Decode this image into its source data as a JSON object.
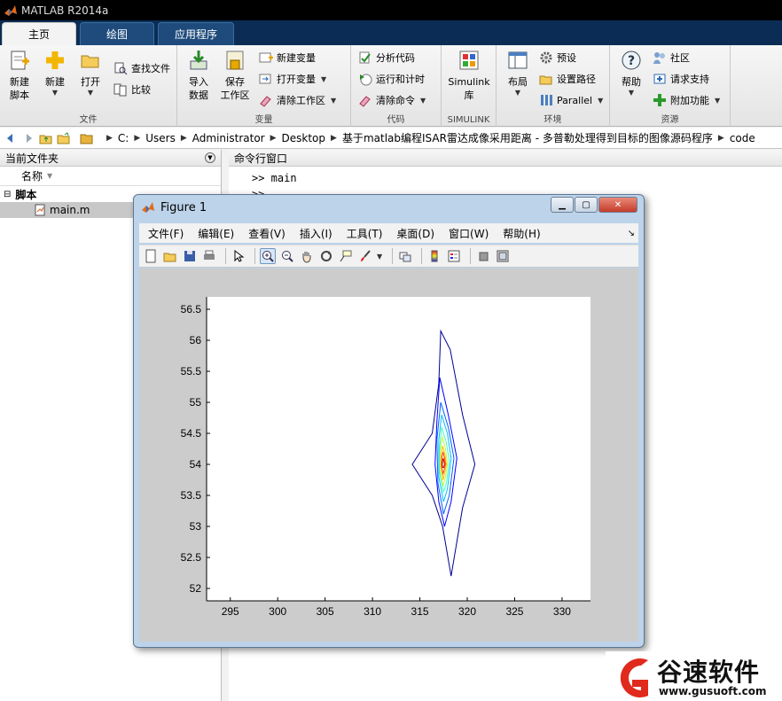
{
  "app": {
    "title": "MATLAB R2014a"
  },
  "ribbon_tabs": [
    {
      "label": "主页",
      "active": true
    },
    {
      "label": "绘图",
      "active": false
    },
    {
      "label": "应用程序",
      "active": false
    }
  ],
  "ribbon": {
    "file": {
      "label": "文件",
      "new_script": "新建\n脚本",
      "new": "新建",
      "open": "打开",
      "find_files": "查找文件",
      "compare": "比较"
    },
    "variable": {
      "label": "变量",
      "import": "导入\n数据",
      "save_workspace": "保存\n工作区",
      "new_variable": "新建变量",
      "open_variable": "打开变量",
      "clear_workspace": "清除工作区"
    },
    "code": {
      "label": "代码",
      "analyze": "分析代码",
      "run_time": "运行和计时",
      "clear_commands": "清除命令"
    },
    "simulink": {
      "label": "SIMULINK",
      "library": "Simulink\n库"
    },
    "environment": {
      "label": "环境",
      "layout": "布局",
      "preferences": "预设",
      "set_path": "设置路径",
      "parallel": "Parallel"
    },
    "resources": {
      "label": "资源",
      "help": "帮助",
      "community": "社区",
      "request_support": "请求支持",
      "addons": "附加功能"
    }
  },
  "address": {
    "crumbs": [
      "C:",
      "Users",
      "Administrator",
      "Desktop",
      "基于matlab编程ISAR雷达成像采用距离 - 多普勒处理得到目标的图像源码程序",
      "code"
    ]
  },
  "current_folder": {
    "title": "当前文件夹",
    "column": "名称",
    "group": "脚本",
    "file": "main.m"
  },
  "command_window": {
    "title": "命令行窗口",
    "prompt_line": ">> main",
    "fx_line": ">>"
  },
  "figure": {
    "title": "Figure 1",
    "menu": [
      "文件(F)",
      "编辑(E)",
      "查看(V)",
      "插入(I)",
      "工具(T)",
      "桌面(D)",
      "窗口(W)",
      "帮助(H)"
    ]
  },
  "chart_data": {
    "type": "contour",
    "title": "",
    "xlabel": "",
    "ylabel": "",
    "xlim": [
      292.5,
      333
    ],
    "ylim": [
      51.8,
      56.7
    ],
    "xticks": [
      295,
      300,
      305,
      310,
      315,
      320,
      325,
      330
    ],
    "yticks": [
      52,
      52.5,
      53,
      53.5,
      54,
      54.5,
      55,
      55.5,
      56,
      56.5
    ],
    "grid": false,
    "levels": [
      {
        "color": "#00008f",
        "points": [
          [
            317.2,
            56.15
          ],
          [
            318.2,
            55.85
          ],
          [
            319.5,
            54.8
          ],
          [
            320.8,
            54.0
          ],
          [
            319.5,
            53.3
          ],
          [
            318.3,
            52.2
          ],
          [
            317.4,
            53.0
          ],
          [
            316.3,
            53.5
          ],
          [
            314.2,
            54.0
          ],
          [
            316.3,
            54.5
          ],
          [
            317.0,
            55.3
          ]
        ]
      },
      {
        "color": "#0000ff",
        "points": [
          [
            317.1,
            55.4
          ],
          [
            318.0,
            54.8
          ],
          [
            318.9,
            54.1
          ],
          [
            318.3,
            53.4
          ],
          [
            317.6,
            53.0
          ],
          [
            317.0,
            53.4
          ],
          [
            316.6,
            54.0
          ],
          [
            316.8,
            54.7
          ]
        ]
      },
      {
        "color": "#0060ff",
        "points": [
          [
            317.2,
            55.0
          ],
          [
            318.0,
            54.6
          ],
          [
            318.6,
            54.1
          ],
          [
            318.1,
            53.5
          ],
          [
            317.5,
            53.2
          ],
          [
            316.9,
            53.7
          ],
          [
            316.8,
            54.4
          ]
        ]
      },
      {
        "color": "#00bfff",
        "points": [
          [
            317.3,
            54.8
          ],
          [
            317.9,
            54.5
          ],
          [
            318.3,
            54.1
          ],
          [
            317.9,
            53.6
          ],
          [
            317.5,
            53.4
          ],
          [
            317.0,
            53.8
          ],
          [
            317.0,
            54.4
          ]
        ]
      },
      {
        "color": "#40ffbf",
        "points": [
          [
            317.3,
            54.6
          ],
          [
            317.8,
            54.35
          ],
          [
            318.1,
            54.05
          ],
          [
            317.8,
            53.7
          ],
          [
            317.5,
            53.55
          ],
          [
            317.1,
            53.85
          ],
          [
            317.1,
            54.3
          ]
        ]
      },
      {
        "color": "#bfff40",
        "points": [
          [
            317.35,
            54.45
          ],
          [
            317.7,
            54.25
          ],
          [
            317.9,
            54.0
          ],
          [
            317.7,
            53.8
          ],
          [
            317.45,
            53.65
          ],
          [
            317.15,
            53.9
          ],
          [
            317.15,
            54.2
          ]
        ]
      },
      {
        "color": "#ffbf00",
        "points": [
          [
            317.4,
            54.3
          ],
          [
            317.65,
            54.15
          ],
          [
            317.8,
            54.0
          ],
          [
            317.6,
            53.85
          ],
          [
            317.45,
            53.75
          ],
          [
            317.25,
            53.95
          ],
          [
            317.25,
            54.15
          ]
        ]
      },
      {
        "color": "#ff4000",
        "points": [
          [
            317.45,
            54.2
          ],
          [
            317.6,
            54.1
          ],
          [
            317.7,
            54.0
          ],
          [
            317.55,
            53.9
          ],
          [
            317.45,
            53.85
          ],
          [
            317.3,
            53.95
          ],
          [
            317.3,
            54.1
          ]
        ]
      },
      {
        "color": "#bf0000",
        "points": [
          [
            317.45,
            54.1
          ],
          [
            317.55,
            54.05
          ],
          [
            317.6,
            54.0
          ],
          [
            317.5,
            53.95
          ],
          [
            317.4,
            53.95
          ],
          [
            317.35,
            54.0
          ]
        ]
      }
    ]
  },
  "watermark": {
    "name": "谷速软件",
    "url": "www.gusuoft.com"
  }
}
